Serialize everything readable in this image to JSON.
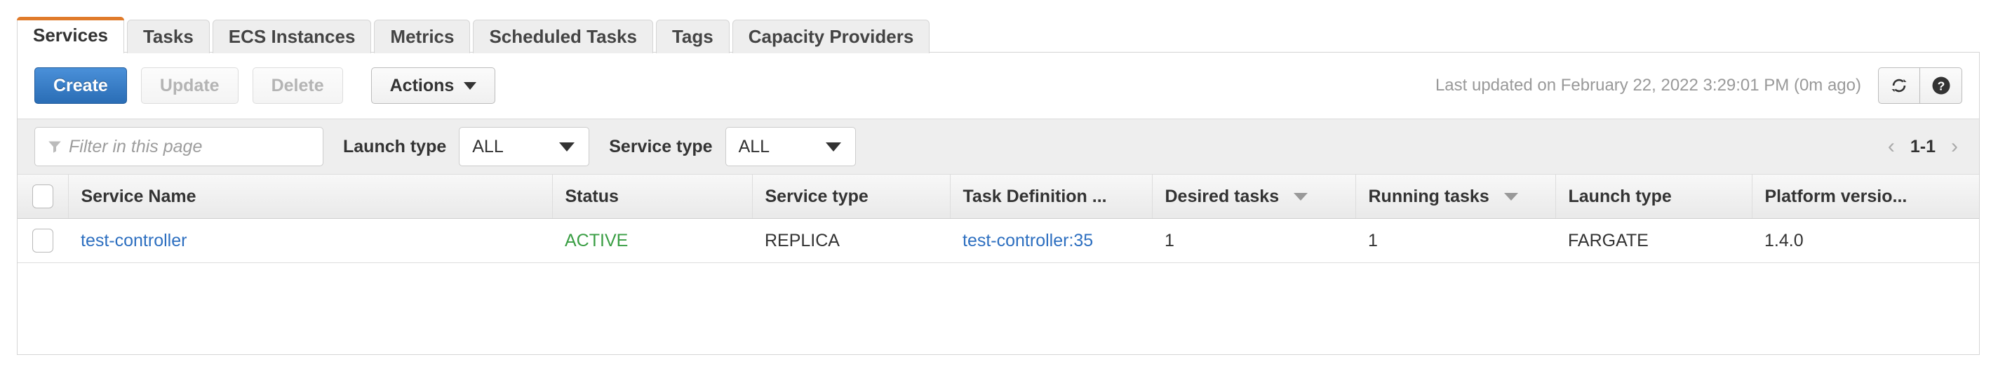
{
  "tabs": [
    {
      "label": "Services",
      "active": true
    },
    {
      "label": "Tasks",
      "active": false
    },
    {
      "label": "ECS Instances",
      "active": false
    },
    {
      "label": "Metrics",
      "active": false
    },
    {
      "label": "Scheduled Tasks",
      "active": false
    },
    {
      "label": "Tags",
      "active": false
    },
    {
      "label": "Capacity Providers",
      "active": false
    }
  ],
  "toolbar": {
    "create_label": "Create",
    "update_label": "Update",
    "delete_label": "Delete",
    "actions_label": "Actions",
    "last_updated": "Last updated on February 22, 2022 3:29:01 PM (0m ago)",
    "refresh_icon": "refresh-icon",
    "help_icon": "help-icon"
  },
  "filters": {
    "filter_placeholder": "Filter in this page",
    "filter_value": "",
    "filter_icon": "funnel-icon",
    "launch_type_label": "Launch type",
    "launch_type_value": "ALL",
    "service_type_label": "Service type",
    "service_type_value": "ALL",
    "pager": {
      "prev_icon": "chevron-left-icon",
      "next_icon": "chevron-right-icon",
      "range": "1-1"
    }
  },
  "table": {
    "columns": [
      {
        "label": "Service Name",
        "sortable": false
      },
      {
        "label": "Status",
        "sortable": false
      },
      {
        "label": "Service type",
        "sortable": false
      },
      {
        "label": "Task Definition ...",
        "sortable": false
      },
      {
        "label": "Desired tasks",
        "sortable": true
      },
      {
        "label": "Running tasks",
        "sortable": true
      },
      {
        "label": "Launch type",
        "sortable": false
      },
      {
        "label": "Platform versio...",
        "sortable": false
      }
    ],
    "rows": [
      {
        "service_name": "test-controller",
        "status": "ACTIVE",
        "service_type": "REPLICA",
        "task_definition": "test-controller:35",
        "desired_tasks": "1",
        "running_tasks": "1",
        "launch_type": "FARGATE",
        "platform_version": "1.4.0"
      }
    ]
  },
  "colors": {
    "accent_orange": "#e07b2b",
    "link_blue": "#2d6fc0",
    "status_green": "#3a9e44",
    "primary_button": "#2a6db5"
  }
}
